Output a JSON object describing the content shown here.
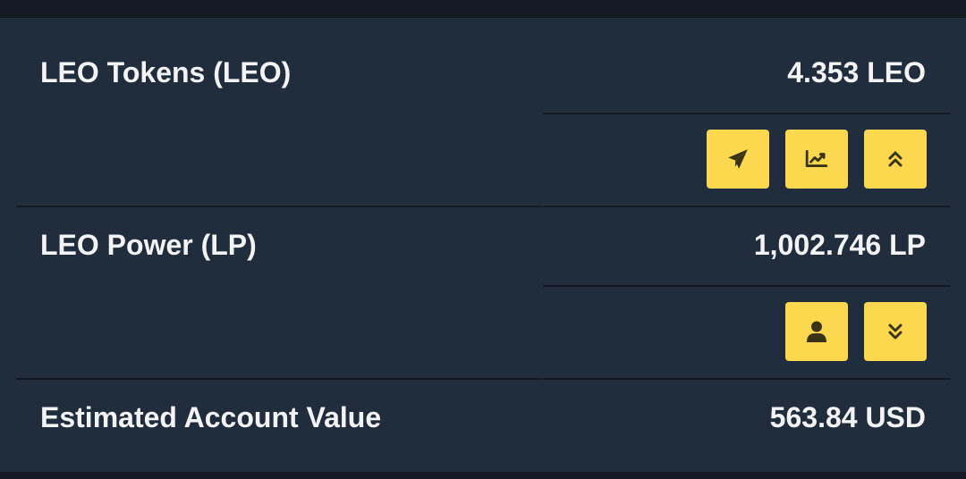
{
  "rows": [
    {
      "label": "LEO Tokens (LEO)",
      "value": "4.353 LEO"
    },
    {
      "label": "LEO Power (LP)",
      "value": "1,002.746 LP"
    },
    {
      "label": "Estimated Account Value",
      "value": "563.84 USD"
    }
  ],
  "actions": {
    "leo_tokens": [
      {
        "icon": "paper-plane-icon",
        "name": "send-button"
      },
      {
        "icon": "chart-line-icon",
        "name": "market-button"
      },
      {
        "icon": "chevron-double-up-icon",
        "name": "power-up-button"
      }
    ],
    "leo_power": [
      {
        "icon": "user-icon",
        "name": "delegate-button"
      },
      {
        "icon": "chevron-double-down-icon",
        "name": "power-down-button"
      }
    ]
  },
  "colors": {
    "background": "#202d3c",
    "button": "#fcd84f",
    "icon": "#3a3416",
    "text": "#f1f3f5"
  }
}
